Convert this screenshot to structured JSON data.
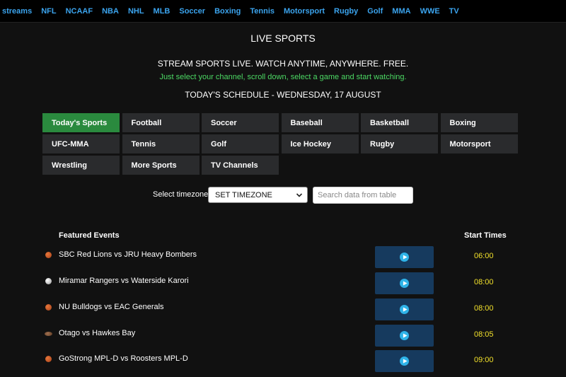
{
  "nav": {
    "items": [
      "streams",
      "NFL",
      "NCAAF",
      "NBA",
      "NHL",
      "MLB",
      "Soccer",
      "Boxing",
      "Tennis",
      "Motorsport",
      "Rugby",
      "Golf",
      "MMA",
      "WWE",
      "TV"
    ]
  },
  "header": {
    "title": "LIVE SPORTS",
    "tagline": "STREAM SPORTS LIVE. WATCH ANYTIME, ANYWHERE. FREE.",
    "instruction": "Just select your channel, scroll down, select a game and start watching.",
    "schedule": "TODAY'S SCHEDULE - WEDNESDAY, 17 AUGUST"
  },
  "categories": [
    "Today's Sports",
    "Football",
    "Soccer",
    "Baseball",
    "Basketball",
    "Boxing",
    "UFC-MMA",
    "Tennis",
    "Golf",
    "Ice Hockey",
    "Rugby",
    "Motorsport",
    "Wrestling",
    "More Sports",
    "TV Channels"
  ],
  "active_category": "Today's Sports",
  "timezone": {
    "label": "Select timezone:",
    "selected": "SET TIMEZONE"
  },
  "search": {
    "placeholder": "Search data from table"
  },
  "table": {
    "headers": {
      "events": "Featured Events",
      "times": "Start Times"
    },
    "rows": [
      {
        "icon": "basketball-icon",
        "name": "SBC Red Lions vs JRU Heavy Bombers",
        "time": "06:00"
      },
      {
        "icon": "soccer-ball-icon",
        "name": "Miramar Rangers vs Waterside Karori",
        "time": "08:00"
      },
      {
        "icon": "basketball-icon",
        "name": "NU Bulldogs vs EAC Generals",
        "time": "08:00"
      },
      {
        "icon": "rugby-ball-icon",
        "name": "Otago vs Hawkes Bay",
        "time": "08:05"
      },
      {
        "icon": "basketball-icon",
        "name": "GoStrong MPL-D vs Roosters MPL-D",
        "time": "09:00"
      }
    ]
  },
  "colors": {
    "background": "#111111",
    "nav_link": "#3ba4ee",
    "active_tab": "#2a8a3e",
    "tab": "#2a2b2d",
    "instruction": "#4cd964",
    "time": "#f2e12b",
    "play_button": "#163a5e",
    "play_icon": "#2fb3e8"
  }
}
